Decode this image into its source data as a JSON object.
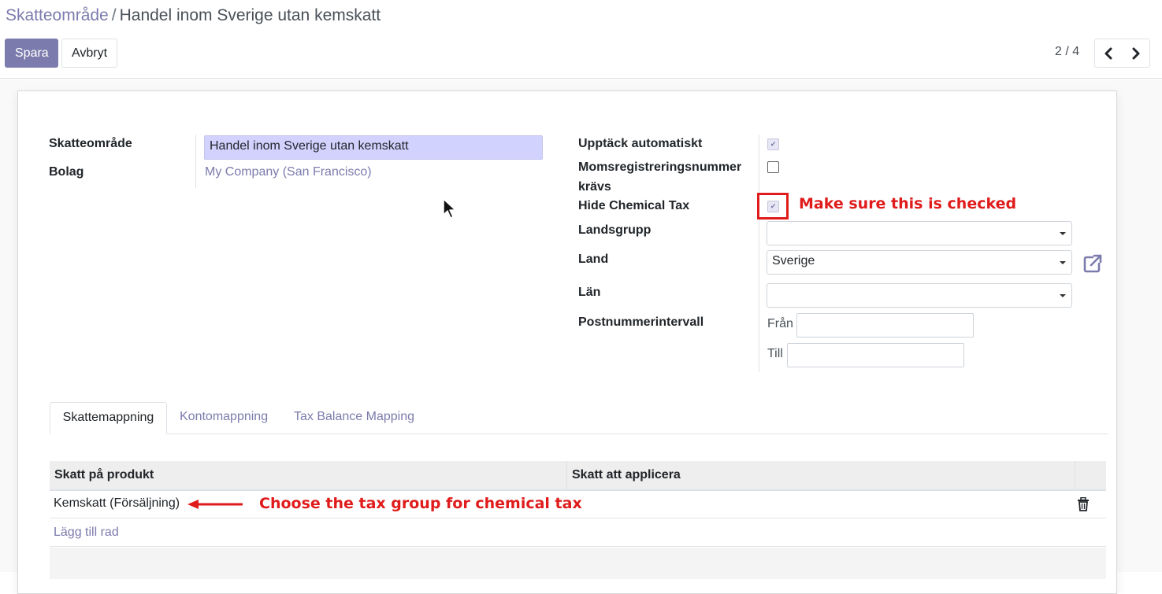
{
  "breadcrumb": {
    "parent": "Skatteområde",
    "separator": "/",
    "current": "Handel inom Sverige utan kemskatt"
  },
  "buttons": {
    "save": "Spara",
    "discard": "Avbryt"
  },
  "pager": {
    "value": "2 / 4"
  },
  "form": {
    "left": {
      "name_label": "Skatteområde",
      "name_value": "Handel inom Sverige utan kemskatt",
      "company_label": "Bolag",
      "company_value": "My Company (San Francisco)"
    },
    "right": {
      "auto_apply_label": "Upptäck automatiskt",
      "auto_apply_checked": true,
      "vat_required_label_1": "Momsregistreringsnummer",
      "vat_required_label_2": "krävs",
      "vat_required_checked": false,
      "hide_chemical_label": "Hide Chemical Tax",
      "hide_chemical_checked": true,
      "country_group_label": "Landsgrupp",
      "country_group_value": "",
      "country_label": "Land",
      "country_value": "Sverige",
      "state_label": "Län",
      "state_value": "",
      "zip_label": "Postnummerintervall",
      "zip_from_label": "Från",
      "zip_from_value": "",
      "zip_to_label": "Till",
      "zip_to_value": ""
    }
  },
  "annotations": {
    "checkbox_note": "Make sure this is checked",
    "row_note": "Choose the tax group for chemical tax",
    "color": "#e01b1b"
  },
  "tabs": [
    {
      "label": "Skattemappning",
      "active": true
    },
    {
      "label": "Kontomappning",
      "active": false
    },
    {
      "label": "Tax Balance Mapping",
      "active": false
    }
  ],
  "table": {
    "headers": [
      "Skatt på produkt",
      "Skatt att applicera"
    ],
    "rows": [
      {
        "tax_src": "Kemskatt (Försäljning)",
        "tax_dest": ""
      }
    ],
    "add_line": "Lägg till rad"
  },
  "colors": {
    "primary": "#7c7bad",
    "highlight_input": "#d2d2ff"
  }
}
